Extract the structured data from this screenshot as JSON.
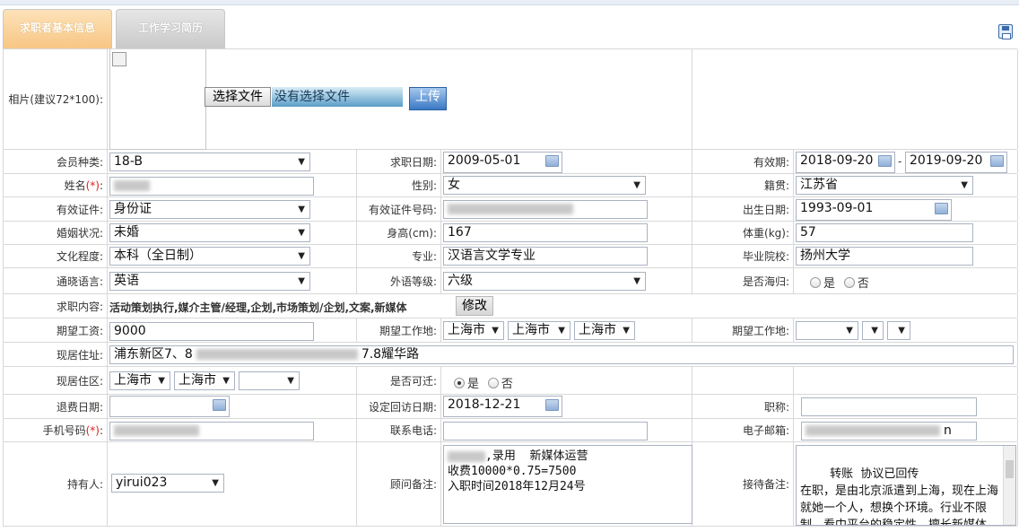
{
  "tabs": [
    {
      "label": "求职者基本信息"
    },
    {
      "label": "工作学习简历"
    }
  ],
  "photo": {
    "label": "相片(建议72*100):",
    "choose_button": "选择文件",
    "file_status": "没有选择文件",
    "upload_button": "上传"
  },
  "rows": {
    "member_type": {
      "label": "会员种类:",
      "value": "18-B"
    },
    "apply_date": {
      "label": "求职日期:",
      "value": "2009-05-01"
    },
    "validity": {
      "label": "有效期:",
      "from": "2018-09-20",
      "sep": "-",
      "to": "2019-09-20"
    },
    "name": {
      "label": "姓名",
      "required": "(*)",
      "colon": ":"
    },
    "gender": {
      "label": "性别:",
      "value": "女"
    },
    "native": {
      "label": "籍贯:",
      "value": "江苏省"
    },
    "id_type": {
      "label": "有效证件:",
      "value": "身份证"
    },
    "id_number": {
      "label": "有效证件号码:"
    },
    "birth": {
      "label": "出生日期:",
      "value": "1993-09-01"
    },
    "marital": {
      "label": "婚姻状况:",
      "value": "未婚"
    },
    "height": {
      "label": "身高(cm):",
      "value": "167"
    },
    "weight": {
      "label": "体重(kg):",
      "value": "57"
    },
    "education": {
      "label": "文化程度:",
      "value": "本科（全日制）"
    },
    "major": {
      "label": "专业:",
      "value": "汉语言文学专业"
    },
    "school": {
      "label": "毕业院校:",
      "value": "扬州大学"
    },
    "language": {
      "label": "通晓语言:",
      "value": "英语"
    },
    "lang_level": {
      "label": "外语等级:",
      "value": "六级"
    },
    "overseas": {
      "label": "是否海归:",
      "yes": "是",
      "no": "否"
    },
    "job_content": {
      "label": "求职内容:",
      "value": "活动策划执行,媒介主管/经理,企划,市场策划/企划,文案,新媒体",
      "edit_button": "修改"
    },
    "salary": {
      "label": "期望工资:",
      "value": "9000"
    },
    "work_place_1": {
      "label": "期望工作地:",
      "province": "上海市",
      "city": "上海市",
      "district": "上海市"
    },
    "work_place_2": {
      "label": "期望工作地:"
    },
    "address": {
      "label": "现居住址:",
      "prefix": "浦东新区7、8",
      "suffix": "7.8耀华路"
    },
    "area": {
      "label": "现居住区:",
      "province": "上海市",
      "city": "上海市"
    },
    "relocate": {
      "label": "是否可迁:",
      "yes": "是",
      "no": "否"
    },
    "refund_date": {
      "label": "退费日期:"
    },
    "revisit_date": {
      "label": "设定回访日期:",
      "value": "2018-12-21"
    },
    "title": {
      "label": "职称:"
    },
    "mobile": {
      "label": "手机号码",
      "required": "(*)",
      "colon": ":"
    },
    "phone": {
      "label": "联系电话:"
    },
    "email": {
      "label": "电子邮箱:",
      "suffix": "n"
    },
    "holder": {
      "label": "持有人:",
      "value": "yirui023"
    },
    "consultant_note": {
      "label": "顾问备注:",
      "value": ",录用  新媒体运营\n收费10000*0.75=7500\n入职时间2018年12月24号"
    },
    "reception_note": {
      "label": "接待备注:",
      "value": "转账  协议已回传\n在职，是由北京派遣到上海，现在上海就她一个人，想换个环境。行业不限制，看中平台的稳定性。擅长新媒体、文案。现在"
    }
  }
}
